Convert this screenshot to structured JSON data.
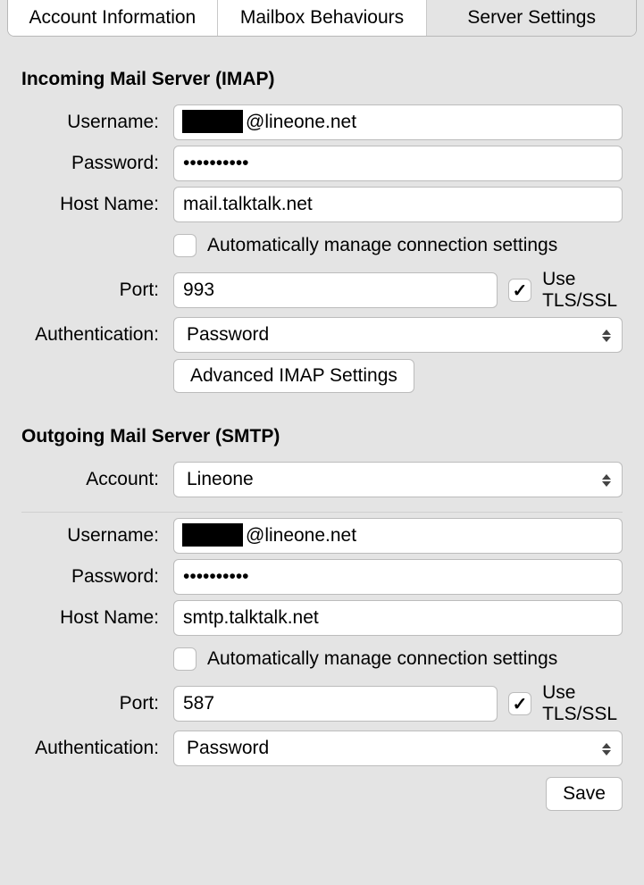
{
  "tabs": {
    "account_info": "Account Information",
    "mailbox_behaviours": "Mailbox Behaviours",
    "server_settings": "Server Settings"
  },
  "incoming": {
    "heading": "Incoming Mail Server (IMAP)",
    "labels": {
      "username": "Username:",
      "password": "Password:",
      "hostname": "Host Name:",
      "port": "Port:",
      "auth": "Authentication:"
    },
    "username_suffix": "@lineone.net",
    "password_display": "••••••••••",
    "hostname": "mail.talktalk.net",
    "auto_manage_label": "Automatically manage connection settings",
    "auto_manage_checked": false,
    "port": "993",
    "tls_label": "Use TLS/SSL",
    "tls_checked": true,
    "auth": "Password",
    "advanced_btn": "Advanced IMAP Settings"
  },
  "outgoing": {
    "heading": "Outgoing Mail Server (SMTP)",
    "labels": {
      "account": "Account:",
      "username": "Username:",
      "password": "Password:",
      "hostname": "Host Name:",
      "port": "Port:",
      "auth": "Authentication:"
    },
    "account": "Lineone",
    "username_suffix": "@lineone.net",
    "password_display": "••••••••••",
    "hostname": "smtp.talktalk.net",
    "auto_manage_label": "Automatically manage connection settings",
    "auto_manage_checked": false,
    "port": "587",
    "tls_label": "Use TLS/SSL",
    "tls_checked": true,
    "auth": "Password"
  },
  "save_btn": "Save"
}
